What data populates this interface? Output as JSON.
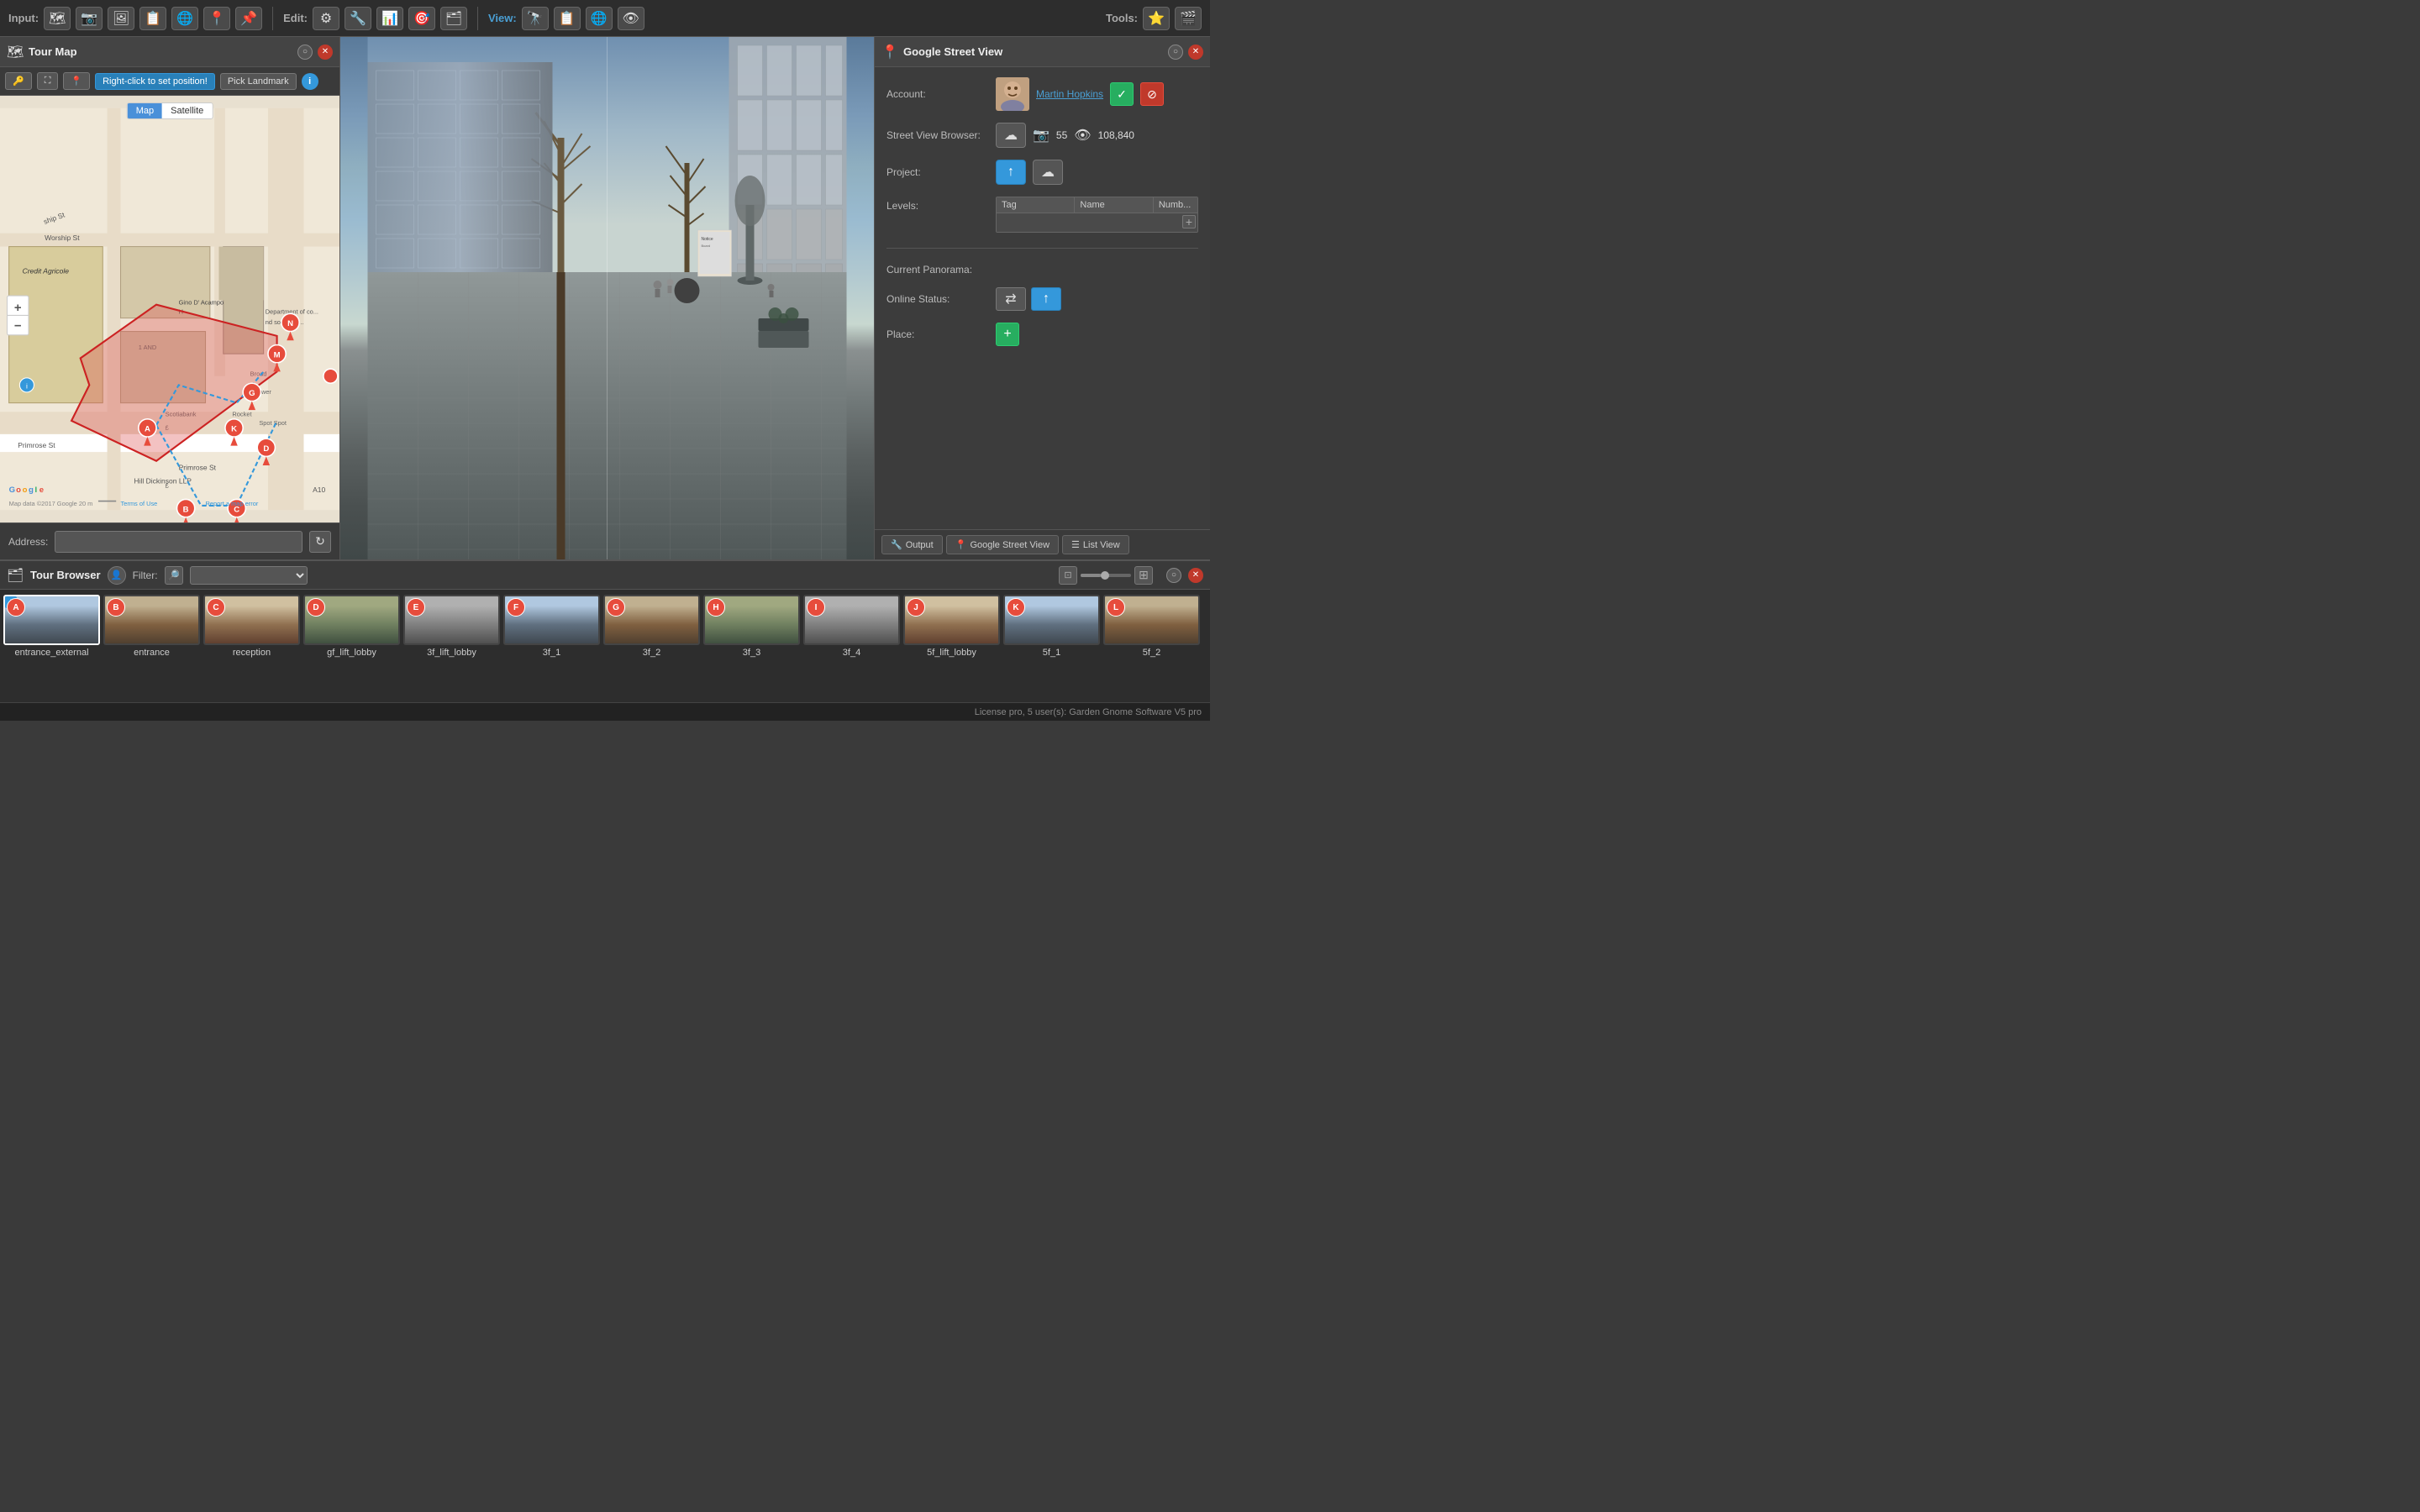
{
  "app": {
    "title": "Tour Map",
    "gsv_title": "Google Street View",
    "browser_title": "Tour Browser"
  },
  "toolbar": {
    "input_label": "Input:",
    "edit_label": "Edit:",
    "view_label": "View:",
    "tools_label": "Tools:"
  },
  "map": {
    "map_tab": "Map",
    "satellite_tab": "Satellite",
    "right_click_hint": "Right-click to set position!",
    "pick_landmark_btn": "Pick Landmark",
    "zoom_in": "+",
    "zoom_out": "−",
    "copyright": "Map data ©2017 Google",
    "scale": "20 m",
    "terms": "Terms of Use",
    "report": "Report a map error"
  },
  "address": {
    "label": "Address:"
  },
  "gsv": {
    "account_label": "Account:",
    "user_name": "Martin Hopkins",
    "street_view_browser_label": "Street View Browser:",
    "photo_count": "55",
    "view_count": "108,840",
    "project_label": "Project:",
    "levels_label": "Levels:",
    "levels_col_tag": "Tag",
    "levels_col_name": "Name",
    "levels_col_numb": "Numb...",
    "current_panorama_label": "Current Panorama:",
    "online_status_label": "Online Status:",
    "place_label": "Place:",
    "output_tab": "Output",
    "gsv_tab": "Google Street View",
    "list_view_tab": "List View"
  },
  "browser": {
    "title": "Tour Browser",
    "filter_label": "Filter:",
    "thumbnails": [
      {
        "id": "A",
        "label": "entrance_external",
        "bg": "exterior",
        "active": true,
        "has_info": true
      },
      {
        "id": "B",
        "label": "entrance",
        "bg": "interior1",
        "active": false
      },
      {
        "id": "C",
        "label": "reception",
        "bg": "interior2",
        "active": false
      },
      {
        "id": "D",
        "label": "gf_lift_lobby",
        "bg": "lobby",
        "active": false
      },
      {
        "id": "E",
        "label": "3f_lift_lobby",
        "bg": "corridor",
        "active": false
      },
      {
        "id": "F",
        "label": "3f_1",
        "bg": "exterior",
        "active": false
      },
      {
        "id": "G",
        "label": "3f_2",
        "bg": "interior1",
        "active": false
      },
      {
        "id": "H",
        "label": "3f_3",
        "bg": "lobby",
        "active": false
      },
      {
        "id": "I",
        "label": "3f_4",
        "bg": "corridor",
        "active": false
      },
      {
        "id": "J",
        "label": "5f_lift_lobby",
        "bg": "interior2",
        "active": false
      },
      {
        "id": "K",
        "label": "5f_1",
        "bg": "exterior",
        "active": false
      },
      {
        "id": "L",
        "label": "5f_2",
        "bg": "interior1",
        "active": false
      }
    ]
  },
  "status_bar": {
    "text": "License pro, 5 user(s): Garden Gnome Software V5 pro"
  }
}
